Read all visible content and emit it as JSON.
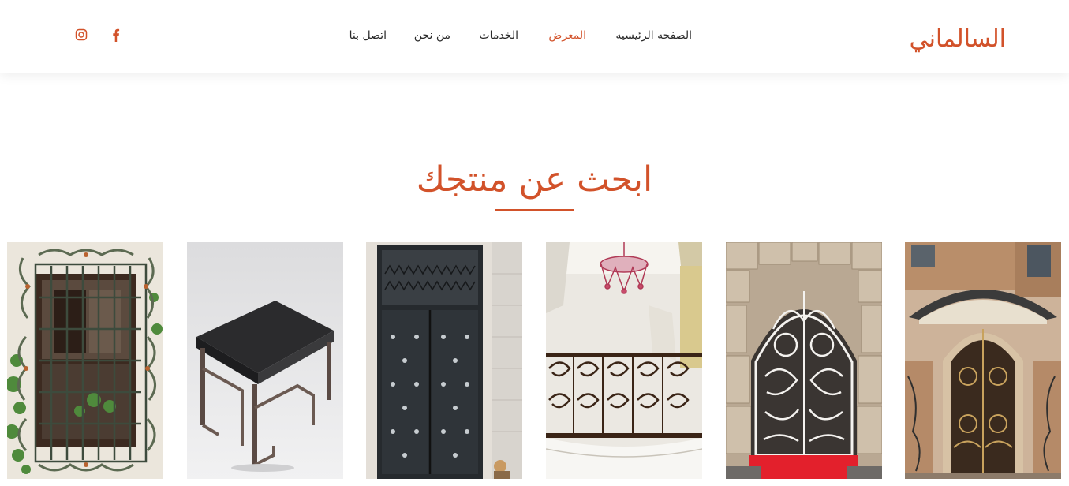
{
  "header": {
    "logo": "السالماني",
    "nav": [
      {
        "label": "الصفحه الرئيسيه",
        "active": false
      },
      {
        "label": "المعرض",
        "active": true
      },
      {
        "label": "الخدمات",
        "active": false
      },
      {
        "label": "من نحن",
        "active": false
      },
      {
        "label": "اتصل بنا",
        "active": false
      }
    ],
    "social": [
      "facebook-icon",
      "instagram-icon"
    ]
  },
  "section": {
    "title": "ابحث عن منتجك"
  },
  "colors": {
    "accent": "#d2522a",
    "text": "#2a2a2a",
    "background": "#ffffff"
  },
  "gallery": {
    "items": [
      {
        "subject": "arched-iron-entrance-door"
      },
      {
        "subject": "ornate-white-iron-gate"
      },
      {
        "subject": "wrought-iron-balcony-railing"
      },
      {
        "subject": "black-iron-double-door"
      },
      {
        "subject": "metal-side-table"
      },
      {
        "subject": "wrought-iron-window-grill"
      }
    ]
  }
}
